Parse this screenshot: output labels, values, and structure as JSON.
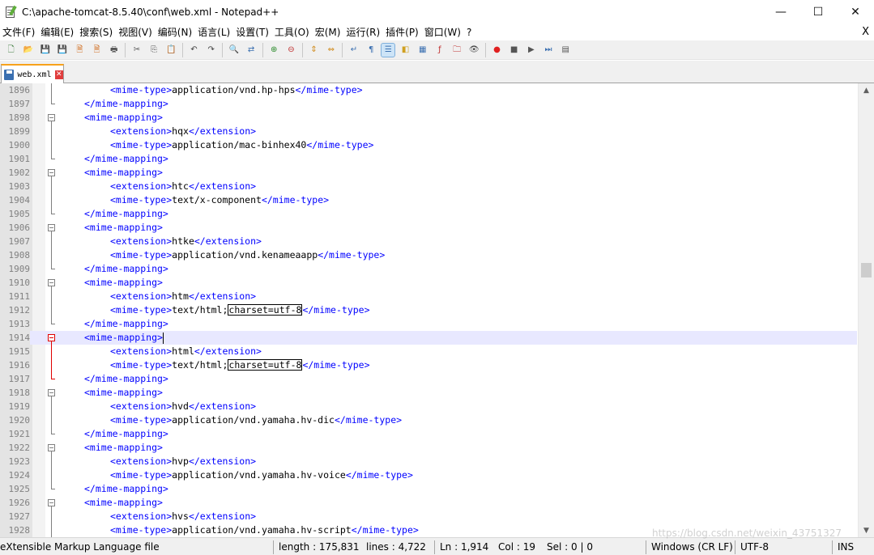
{
  "window": {
    "title": "C:\\apache-tomcat-8.5.40\\conf\\web.xml - Notepad++",
    "controls": {
      "minimize": "—",
      "maximize": "☐",
      "close": "✕"
    }
  },
  "menu": {
    "items": [
      "文件(F)",
      "编辑(E)",
      "搜索(S)",
      "视图(V)",
      "编码(N)",
      "语言(L)",
      "设置(T)",
      "工具(O)",
      "宏(M)",
      "运行(R)",
      "插件(P)",
      "窗口(W)",
      "?"
    ],
    "close_glyph": "X"
  },
  "toolbar": {
    "buttons": [
      {
        "name": "new-file-icon",
        "glyph": "🗋",
        "color": "#3a7a3a"
      },
      {
        "name": "open-file-icon",
        "glyph": "📂",
        "color": "#c28a1e"
      },
      {
        "name": "save-icon",
        "glyph": "💾",
        "color": "#3a6fb0"
      },
      {
        "name": "save-all-icon",
        "glyph": "💾",
        "color": "#3a6fb0"
      },
      {
        "name": "close-file-icon",
        "glyph": "🗎",
        "color": "#d06a1a"
      },
      {
        "name": "close-all-icon",
        "glyph": "🗎",
        "color": "#d06a1a"
      },
      {
        "name": "print-icon",
        "glyph": "🖶",
        "color": "#555555"
      },
      {
        "sep": true
      },
      {
        "name": "cut-icon",
        "glyph": "✂",
        "color": "#555555"
      },
      {
        "name": "copy-icon",
        "glyph": "⎘",
        "color": "#555555"
      },
      {
        "name": "paste-icon",
        "glyph": "📋",
        "color": "#a07a2a"
      },
      {
        "sep": true
      },
      {
        "name": "undo-icon",
        "glyph": "↶",
        "color": "#444444"
      },
      {
        "name": "redo-icon",
        "glyph": "↷",
        "color": "#444444"
      },
      {
        "sep": true
      },
      {
        "name": "find-icon",
        "glyph": "🔍",
        "color": "#444444"
      },
      {
        "name": "replace-icon",
        "glyph": "⇄",
        "color": "#3a6fb0"
      },
      {
        "sep": true
      },
      {
        "name": "zoom-in-icon",
        "glyph": "⊕",
        "color": "#2a8a2a"
      },
      {
        "name": "zoom-out-icon",
        "glyph": "⊖",
        "color": "#c03030"
      },
      {
        "sep": true
      },
      {
        "name": "sync-vertical-icon",
        "glyph": "⇕",
        "color": "#d08a1a"
      },
      {
        "name": "sync-horizontal-icon",
        "glyph": "⇔",
        "color": "#d08a1a"
      },
      {
        "sep": true
      },
      {
        "name": "word-wrap-icon",
        "glyph": "↵",
        "color": "#3a6fb0"
      },
      {
        "name": "show-all-chars-icon",
        "glyph": "¶",
        "color": "#3a6fb0"
      },
      {
        "name": "indent-guide-icon",
        "glyph": "☰",
        "color": "#3a6fb0",
        "active": true
      },
      {
        "name": "udl-icon",
        "glyph": "◧",
        "color": "#d0a020"
      },
      {
        "name": "doc-map-icon",
        "glyph": "▦",
        "color": "#3a6fb0"
      },
      {
        "name": "function-list-icon",
        "glyph": "ƒ",
        "color": "#c03030"
      },
      {
        "name": "folder-workspace-icon",
        "glyph": "🗀",
        "color": "#c03030"
      },
      {
        "name": "monitoring-icon",
        "glyph": "👁",
        "color": "#444444"
      },
      {
        "sep": true
      },
      {
        "name": "record-macro-icon",
        "glyph": "●",
        "color": "#e02020"
      },
      {
        "name": "stop-macro-icon",
        "glyph": "■",
        "color": "#555555"
      },
      {
        "name": "play-macro-icon",
        "glyph": "▶",
        "color": "#555555"
      },
      {
        "name": "run-macro-multiple-icon",
        "glyph": "⏭",
        "color": "#3a6fb0"
      },
      {
        "name": "save-macro-icon",
        "glyph": "▤",
        "color": "#555555"
      }
    ]
  },
  "tab": {
    "label": "web.xml",
    "close_glyph": "✕"
  },
  "editor": {
    "current_line": 1914,
    "lines": [
      {
        "n": "1896",
        "indent": 2,
        "parts": [
          {
            "t": "tag",
            "v": "<mime-type>"
          },
          {
            "t": "txt",
            "v": "application/vnd.hp-hps"
          },
          {
            "t": "tag",
            "v": "</mime-type>"
          }
        ]
      },
      {
        "n": "1897",
        "indent": 1,
        "parts": [
          {
            "t": "tag",
            "v": "</mime-mapping>"
          }
        ]
      },
      {
        "n": "1898",
        "indent": 1,
        "parts": [
          {
            "t": "tag",
            "v": "<mime-mapping>"
          }
        ]
      },
      {
        "n": "1899",
        "indent": 2,
        "parts": [
          {
            "t": "tag",
            "v": "<extension>"
          },
          {
            "t": "txt",
            "v": "hqx"
          },
          {
            "t": "tag",
            "v": "</extension>"
          }
        ]
      },
      {
        "n": "1900",
        "indent": 2,
        "parts": [
          {
            "t": "tag",
            "v": "<mime-type>"
          },
          {
            "t": "txt",
            "v": "application/mac-binhex40"
          },
          {
            "t": "tag",
            "v": "</mime-type>"
          }
        ]
      },
      {
        "n": "1901",
        "indent": 1,
        "parts": [
          {
            "t": "tag",
            "v": "</mime-mapping>"
          }
        ]
      },
      {
        "n": "1902",
        "indent": 1,
        "parts": [
          {
            "t": "tag",
            "v": "<mime-mapping>"
          }
        ]
      },
      {
        "n": "1903",
        "indent": 2,
        "parts": [
          {
            "t": "tag",
            "v": "<extension>"
          },
          {
            "t": "txt",
            "v": "htc"
          },
          {
            "t": "tag",
            "v": "</extension>"
          }
        ]
      },
      {
        "n": "1904",
        "indent": 2,
        "parts": [
          {
            "t": "tag",
            "v": "<mime-type>"
          },
          {
            "t": "txt",
            "v": "text/x-component"
          },
          {
            "t": "tag",
            "v": "</mime-type>"
          }
        ]
      },
      {
        "n": "1905",
        "indent": 1,
        "parts": [
          {
            "t": "tag",
            "v": "</mime-mapping>"
          }
        ]
      },
      {
        "n": "1906",
        "indent": 1,
        "parts": [
          {
            "t": "tag",
            "v": "<mime-mapping>"
          }
        ]
      },
      {
        "n": "1907",
        "indent": 2,
        "parts": [
          {
            "t": "tag",
            "v": "<extension>"
          },
          {
            "t": "txt",
            "v": "htke"
          },
          {
            "t": "tag",
            "v": "</extension>"
          }
        ]
      },
      {
        "n": "1908",
        "indent": 2,
        "parts": [
          {
            "t": "tag",
            "v": "<mime-type>"
          },
          {
            "t": "txt",
            "v": "application/vnd.kenameaapp"
          },
          {
            "t": "tag",
            "v": "</mime-type>"
          }
        ]
      },
      {
        "n": "1909",
        "indent": 1,
        "parts": [
          {
            "t": "tag",
            "v": "</mime-mapping>"
          }
        ]
      },
      {
        "n": "1910",
        "indent": 1,
        "parts": [
          {
            "t": "tag",
            "v": "<mime-mapping>"
          }
        ]
      },
      {
        "n": "1911",
        "indent": 2,
        "parts": [
          {
            "t": "tag",
            "v": "<extension>"
          },
          {
            "t": "txt",
            "v": "htm"
          },
          {
            "t": "tag",
            "v": "</extension>"
          }
        ]
      },
      {
        "n": "1912",
        "indent": 2,
        "parts": [
          {
            "t": "tag",
            "v": "<mime-type>"
          },
          {
            "t": "txt",
            "v": "text/html;"
          },
          {
            "t": "boxed",
            "v": "charset=utf-8"
          },
          {
            "t": "tag",
            "v": "</mime-type>"
          }
        ]
      },
      {
        "n": "1913",
        "indent": 1,
        "parts": [
          {
            "t": "tag",
            "v": "</mime-mapping>"
          }
        ]
      },
      {
        "n": "1914",
        "indent": 1,
        "parts": [
          {
            "t": "tag",
            "v": "<mime-mapping>"
          },
          {
            "t": "caret",
            "v": ""
          }
        ]
      },
      {
        "n": "1915",
        "indent": 2,
        "parts": [
          {
            "t": "tag",
            "v": "<extension>"
          },
          {
            "t": "txt",
            "v": "html"
          },
          {
            "t": "tag",
            "v": "</extension>"
          }
        ]
      },
      {
        "n": "1916",
        "indent": 2,
        "parts": [
          {
            "t": "tag",
            "v": "<mime-type>"
          },
          {
            "t": "txt",
            "v": "text/html;"
          },
          {
            "t": "boxed",
            "v": "charset=utf-8"
          },
          {
            "t": "tag",
            "v": "</mime-type>"
          }
        ]
      },
      {
        "n": "1917",
        "indent": 1,
        "parts": [
          {
            "t": "tag",
            "v": "</mime-mapping>"
          }
        ]
      },
      {
        "n": "1918",
        "indent": 1,
        "parts": [
          {
            "t": "tag",
            "v": "<mime-mapping>"
          }
        ]
      },
      {
        "n": "1919",
        "indent": 2,
        "parts": [
          {
            "t": "tag",
            "v": "<extension>"
          },
          {
            "t": "txt",
            "v": "hvd"
          },
          {
            "t": "tag",
            "v": "</extension>"
          }
        ]
      },
      {
        "n": "1920",
        "indent": 2,
        "parts": [
          {
            "t": "tag",
            "v": "<mime-type>"
          },
          {
            "t": "txt",
            "v": "application/vnd.yamaha.hv-dic"
          },
          {
            "t": "tag",
            "v": "</mime-type>"
          }
        ]
      },
      {
        "n": "1921",
        "indent": 1,
        "parts": [
          {
            "t": "tag",
            "v": "</mime-mapping>"
          }
        ]
      },
      {
        "n": "1922",
        "indent": 1,
        "parts": [
          {
            "t": "tag",
            "v": "<mime-mapping>"
          }
        ]
      },
      {
        "n": "1923",
        "indent": 2,
        "parts": [
          {
            "t": "tag",
            "v": "<extension>"
          },
          {
            "t": "txt",
            "v": "hvp"
          },
          {
            "t": "tag",
            "v": "</extension>"
          }
        ]
      },
      {
        "n": "1924",
        "indent": 2,
        "parts": [
          {
            "t": "tag",
            "v": "<mime-type>"
          },
          {
            "t": "txt",
            "v": "application/vnd.yamaha.hv-voice"
          },
          {
            "t": "tag",
            "v": "</mime-type>"
          }
        ]
      },
      {
        "n": "1925",
        "indent": 1,
        "parts": [
          {
            "t": "tag",
            "v": "</mime-mapping>"
          }
        ]
      },
      {
        "n": "1926",
        "indent": 1,
        "parts": [
          {
            "t": "tag",
            "v": "<mime-mapping>"
          }
        ]
      },
      {
        "n": "1927",
        "indent": 2,
        "parts": [
          {
            "t": "tag",
            "v": "<extension>"
          },
          {
            "t": "txt",
            "v": "hvs"
          },
          {
            "t": "tag",
            "v": "</extension>"
          }
        ]
      },
      {
        "n": "1928",
        "indent": 2,
        "parts": [
          {
            "t": "tag",
            "v": "<mime-type>"
          },
          {
            "t": "txt",
            "v": "application/vnd.yamaha.hv-script"
          },
          {
            "t": "tag",
            "v": "</mime-type>"
          }
        ]
      }
    ]
  },
  "statusbar": {
    "file_type": "eXtensible Markup Language file",
    "length": "length : 175,831",
    "lines": "lines : 4,722",
    "ln": "Ln : 1,914",
    "col": "Col : 19",
    "sel": "Sel : 0 | 0",
    "eol": "Windows (CR LF)",
    "encoding": "UTF-8",
    "mode": "INS"
  },
  "watermark": "https://blog.csdn.net/weixin_43751327",
  "colors": {
    "tag": "#0000ff",
    "text": "#000000",
    "current_line": "#e8e8ff",
    "gutter": "#e4e4e4",
    "tab_accent": "#f7a21b"
  }
}
